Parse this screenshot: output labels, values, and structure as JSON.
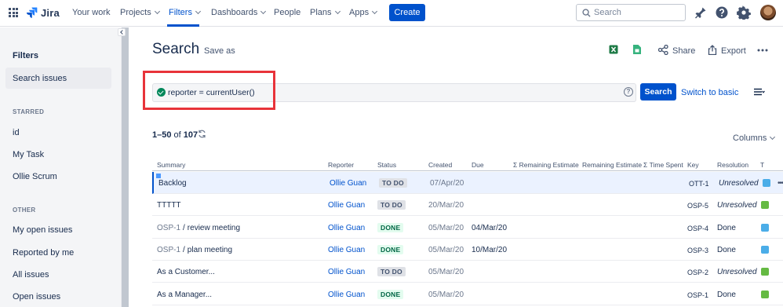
{
  "topnav": {
    "app_name": "Jira",
    "items": [
      {
        "label": "Your work",
        "caret": false
      },
      {
        "label": "Projects",
        "caret": true
      },
      {
        "label": "Filters",
        "caret": true,
        "active": true
      },
      {
        "label": "Dashboards",
        "caret": true
      },
      {
        "label": "People",
        "caret": false
      },
      {
        "label": "Plans",
        "caret": true
      },
      {
        "label": "Apps",
        "caret": true
      }
    ],
    "create_label": "Create",
    "search_placeholder": "Search",
    "icons": [
      "apps-grid-icon",
      "notifications-icon",
      "help-icon",
      "settings-icon",
      "avatar"
    ]
  },
  "sidebar": {
    "title": "Filters",
    "selected": "Search issues",
    "starred_heading": "STARRED",
    "starred": [
      "id",
      "My Task",
      "Ollie Scrum"
    ],
    "other_heading": "OTHER",
    "other": [
      "My open issues",
      "Reported by me",
      "All issues",
      "Open issues"
    ]
  },
  "header": {
    "title": "Search",
    "save_as": "Save as",
    "share": "Share",
    "export": "Export"
  },
  "query": {
    "jql": "reporter = currentUser()",
    "search_label": "Search",
    "switch_label": "Switch to basic",
    "help_glyph": "?"
  },
  "results": {
    "range": "1–50",
    "of": "of",
    "total": "107",
    "columns_label": "Columns"
  },
  "table": {
    "headers": [
      "Summary",
      "Reporter",
      "Status",
      "Created",
      "Due",
      "Σ Remaining Estimate",
      "Remaining Estimate",
      "Σ Time Spent",
      "Key",
      "Resolution",
      "T"
    ],
    "rows": [
      {
        "parent": "",
        "summary": "Backlog",
        "reporter": "Ollie Guan",
        "status": "TO DO",
        "created": "07/Apr/20",
        "due": "",
        "key": "OTT-1",
        "resolution": "Unresolved",
        "type": "check"
      },
      {
        "parent": "",
        "summary": "TTTTT",
        "reporter": "Ollie Guan",
        "status": "TO DO",
        "created": "20/Mar/20",
        "due": "",
        "key": "OSP-5",
        "resolution": "Unresolved",
        "type": "story"
      },
      {
        "parent": "OSP-1",
        "summary": "review meeting",
        "reporter": "Ollie Guan",
        "status": "DONE",
        "created": "05/Mar/20",
        "due": "04/Mar/20",
        "key": "OSP-4",
        "resolution": "Done",
        "type": "task"
      },
      {
        "parent": "OSP-1",
        "summary": "plan meeting",
        "reporter": "Ollie Guan",
        "status": "DONE",
        "created": "05/Mar/20",
        "due": "10/Mar/20",
        "key": "OSP-3",
        "resolution": "Done",
        "type": "task"
      },
      {
        "parent": "",
        "summary": "As a Customer...",
        "reporter": "Ollie Guan",
        "status": "TO DO",
        "created": "05/Mar/20",
        "due": "",
        "key": "OSP-2",
        "resolution": "Unresolved",
        "type": "story"
      },
      {
        "parent": "",
        "summary": "As a Manager...",
        "reporter": "Ollie Guan",
        "status": "DONE",
        "created": "05/Mar/20",
        "due": "",
        "key": "OSP-1",
        "resolution": "Done",
        "type": "story"
      }
    ]
  },
  "colors": {
    "brand": "#0052CC",
    "highlight": "#E8333A",
    "done_bg": "#E3FCEF",
    "todo_bg": "#DFE1E6"
  }
}
